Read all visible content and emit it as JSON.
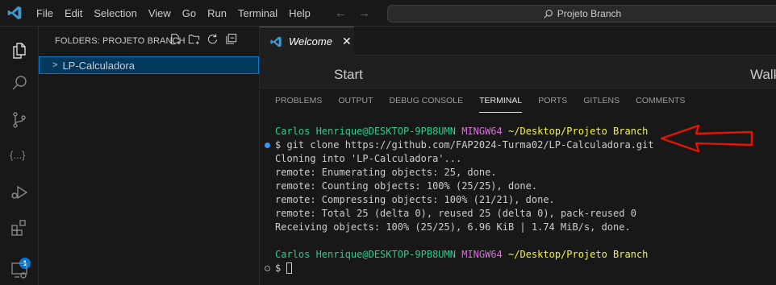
{
  "menu": {
    "items": [
      "File",
      "Edit",
      "Selection",
      "View",
      "Go",
      "Run",
      "Terminal",
      "Help"
    ],
    "back_arrow": "←",
    "forward_arrow": "→"
  },
  "command_center": {
    "label": "Projeto Branch"
  },
  "activity_bar": {
    "items": [
      "explorer-icon",
      "search-icon",
      "source-control-icon",
      "json-icon",
      "run-debug-icon",
      "extensions-icon",
      "remote-explorer-icon"
    ],
    "extensions_badge": "1"
  },
  "sidebar": {
    "header": "FOLDERS: PROJETO BRANCH",
    "actions": [
      "new-file-icon",
      "new-folder-icon",
      "refresh-icon",
      "collapse-all-icon"
    ],
    "folder": {
      "chevron": ">",
      "label": "LP-Calculadora"
    }
  },
  "editor": {
    "tab": {
      "label": "Welcome",
      "close": "✕"
    },
    "welcome_start": "Start",
    "welcome_walk": "Walk"
  },
  "panel": {
    "tabs": [
      "PROBLEMS",
      "OUTPUT",
      "DEBUG CONSOLE",
      "TERMINAL",
      "PORTS",
      "GITLENS",
      "COMMENTS"
    ],
    "active_tab": "TERMINAL"
  },
  "terminal": {
    "prompt_user": "Carlos Henrique@DESKTOP-9PB8UMN",
    "prompt_ming": "MINGW64",
    "prompt_path": "~/Desktop/Projeto Branch",
    "command": "$ git clone https://github.com/FAP2024-Turma02/LP-Calculadora.git",
    "output": [
      "Cloning into 'LP-Calculadora'...",
      "remote: Enumerating objects: 25, done.",
      "remote: Counting objects: 100% (25/25), done.",
      "remote: Compressing objects: 100% (21/21), done.",
      "remote: Total 25 (delta 0), reused 25 (delta 0), pack-reused 0",
      "Receiving objects: 100% (25/25), 6.96 KiB | 1.74 MiB/s, done."
    ],
    "prompt2_user": "Carlos Henrique@DESKTOP-9PB8UMN",
    "prompt2_ming": "MINGW64",
    "prompt2_path": "~/Desktop/Projeto Branch",
    "input_prompt": "$ "
  },
  "colors": {
    "accent": "#0078d4",
    "terminal_user": "#23d18b",
    "terminal_ming": "#d670d6",
    "terminal_path": "#f5f543",
    "annotation_arrow": "#e51400"
  }
}
